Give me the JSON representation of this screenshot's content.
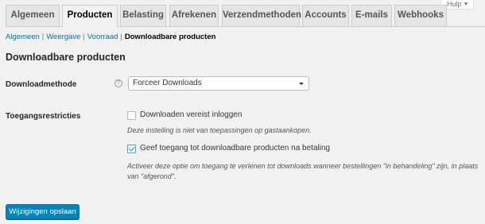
{
  "help": {
    "label": "Hulp"
  },
  "tabs": [
    {
      "label": "Algemeen",
      "active": false
    },
    {
      "label": "Producten",
      "active": true
    },
    {
      "label": "Belasting",
      "active": false
    },
    {
      "label": "Afrekenen",
      "active": false
    },
    {
      "label": "Verzendmethoden",
      "active": false
    },
    {
      "label": "Accounts",
      "active": false
    },
    {
      "label": "E-mails",
      "active": false
    },
    {
      "label": "Webhooks",
      "active": false
    }
  ],
  "subnav": {
    "items": [
      "Algemeen",
      "Weergave",
      "Voorraad"
    ],
    "separator": "|",
    "current": "Downloadbare producten"
  },
  "section": {
    "title": "Downloadbare producten"
  },
  "download_method": {
    "label": "Downloadmethode",
    "help_icon": "?",
    "value": "Forceer Downloads"
  },
  "access": {
    "label": "Toegangsrestricties",
    "option1": {
      "label": "Downloaden vereist inloggen",
      "checked": false
    },
    "option1_desc": "Deze instelling is niet van toepassingen op gastaankopen.",
    "option2": {
      "label": "Geef toegang tot downloadbare producten na betaling",
      "checked": true
    },
    "option2_desc": "Activeer deze optie om toegang te verlenen tot downloads wanneer bestellingen \"in behandeling\" zijn, in plaats van \"afgerond\"."
  },
  "save_button": {
    "label": "Wijzigingen opslaan"
  },
  "colors": {
    "accent": "#0085ba",
    "link": "#0073aa",
    "background": "#f1f1f1"
  }
}
